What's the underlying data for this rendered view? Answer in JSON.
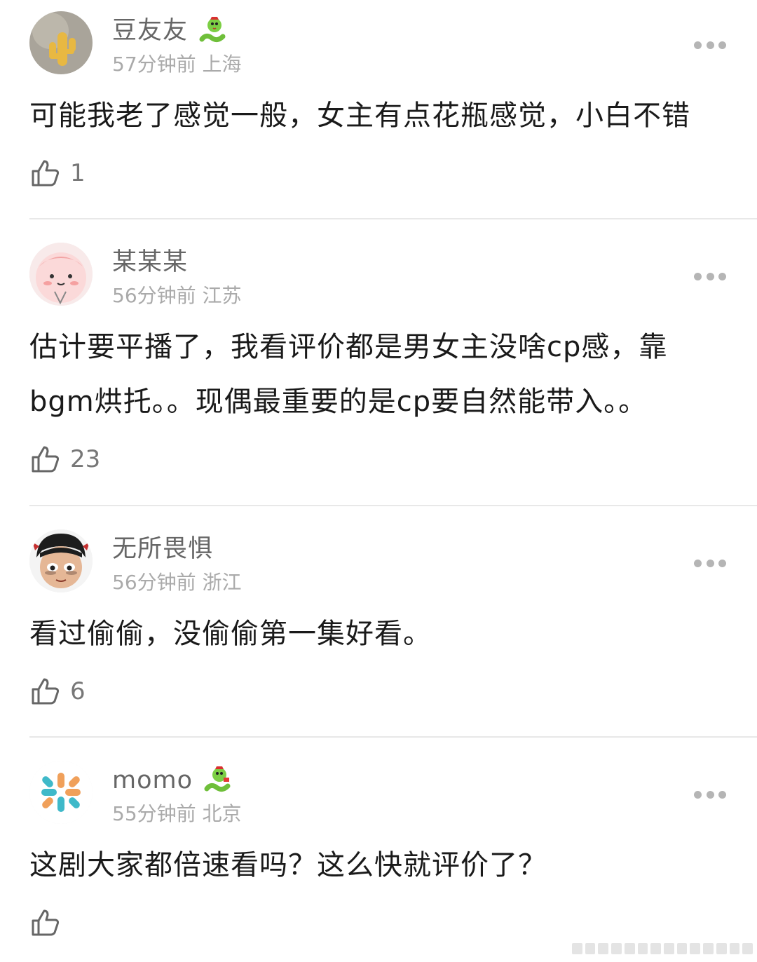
{
  "comments": [
    {
      "username": "豆友友",
      "has_badge": true,
      "time": "57分钟前",
      "location": "上海",
      "text": "可能我老了感觉一般，女主有点花瓶感觉，小白不错",
      "likes": "1",
      "avatar": "cactus-avatar"
    },
    {
      "username": "某某某",
      "has_badge": false,
      "time": "56分钟前",
      "location": "江苏",
      "text": "估计要平播了，我看评价都是男女主没啥cp感，靠bgm烘托。。现偶最重要的是cp要自然能带入。。",
      "likes": "23",
      "avatar": "pink-cartoon-avatar"
    },
    {
      "username": "无所畏惧",
      "has_badge": false,
      "time": "56分钟前",
      "location": "浙江",
      "text": "看过偷偷，没偷偷第一集好看。",
      "likes": "6",
      "avatar": "cartoon-kid-avatar"
    },
    {
      "username": "momo",
      "has_badge": true,
      "time": "55分钟前",
      "location": "北京",
      "text": "这剧大家都倍速看吗？这么快就评价了？",
      "likes": "",
      "avatar": "pattern-avatar"
    }
  ],
  "colors": {
    "name": "#666666",
    "meta": "#aaaaaa",
    "text": "#1a1a1a",
    "divider": "#e8e8e8"
  }
}
